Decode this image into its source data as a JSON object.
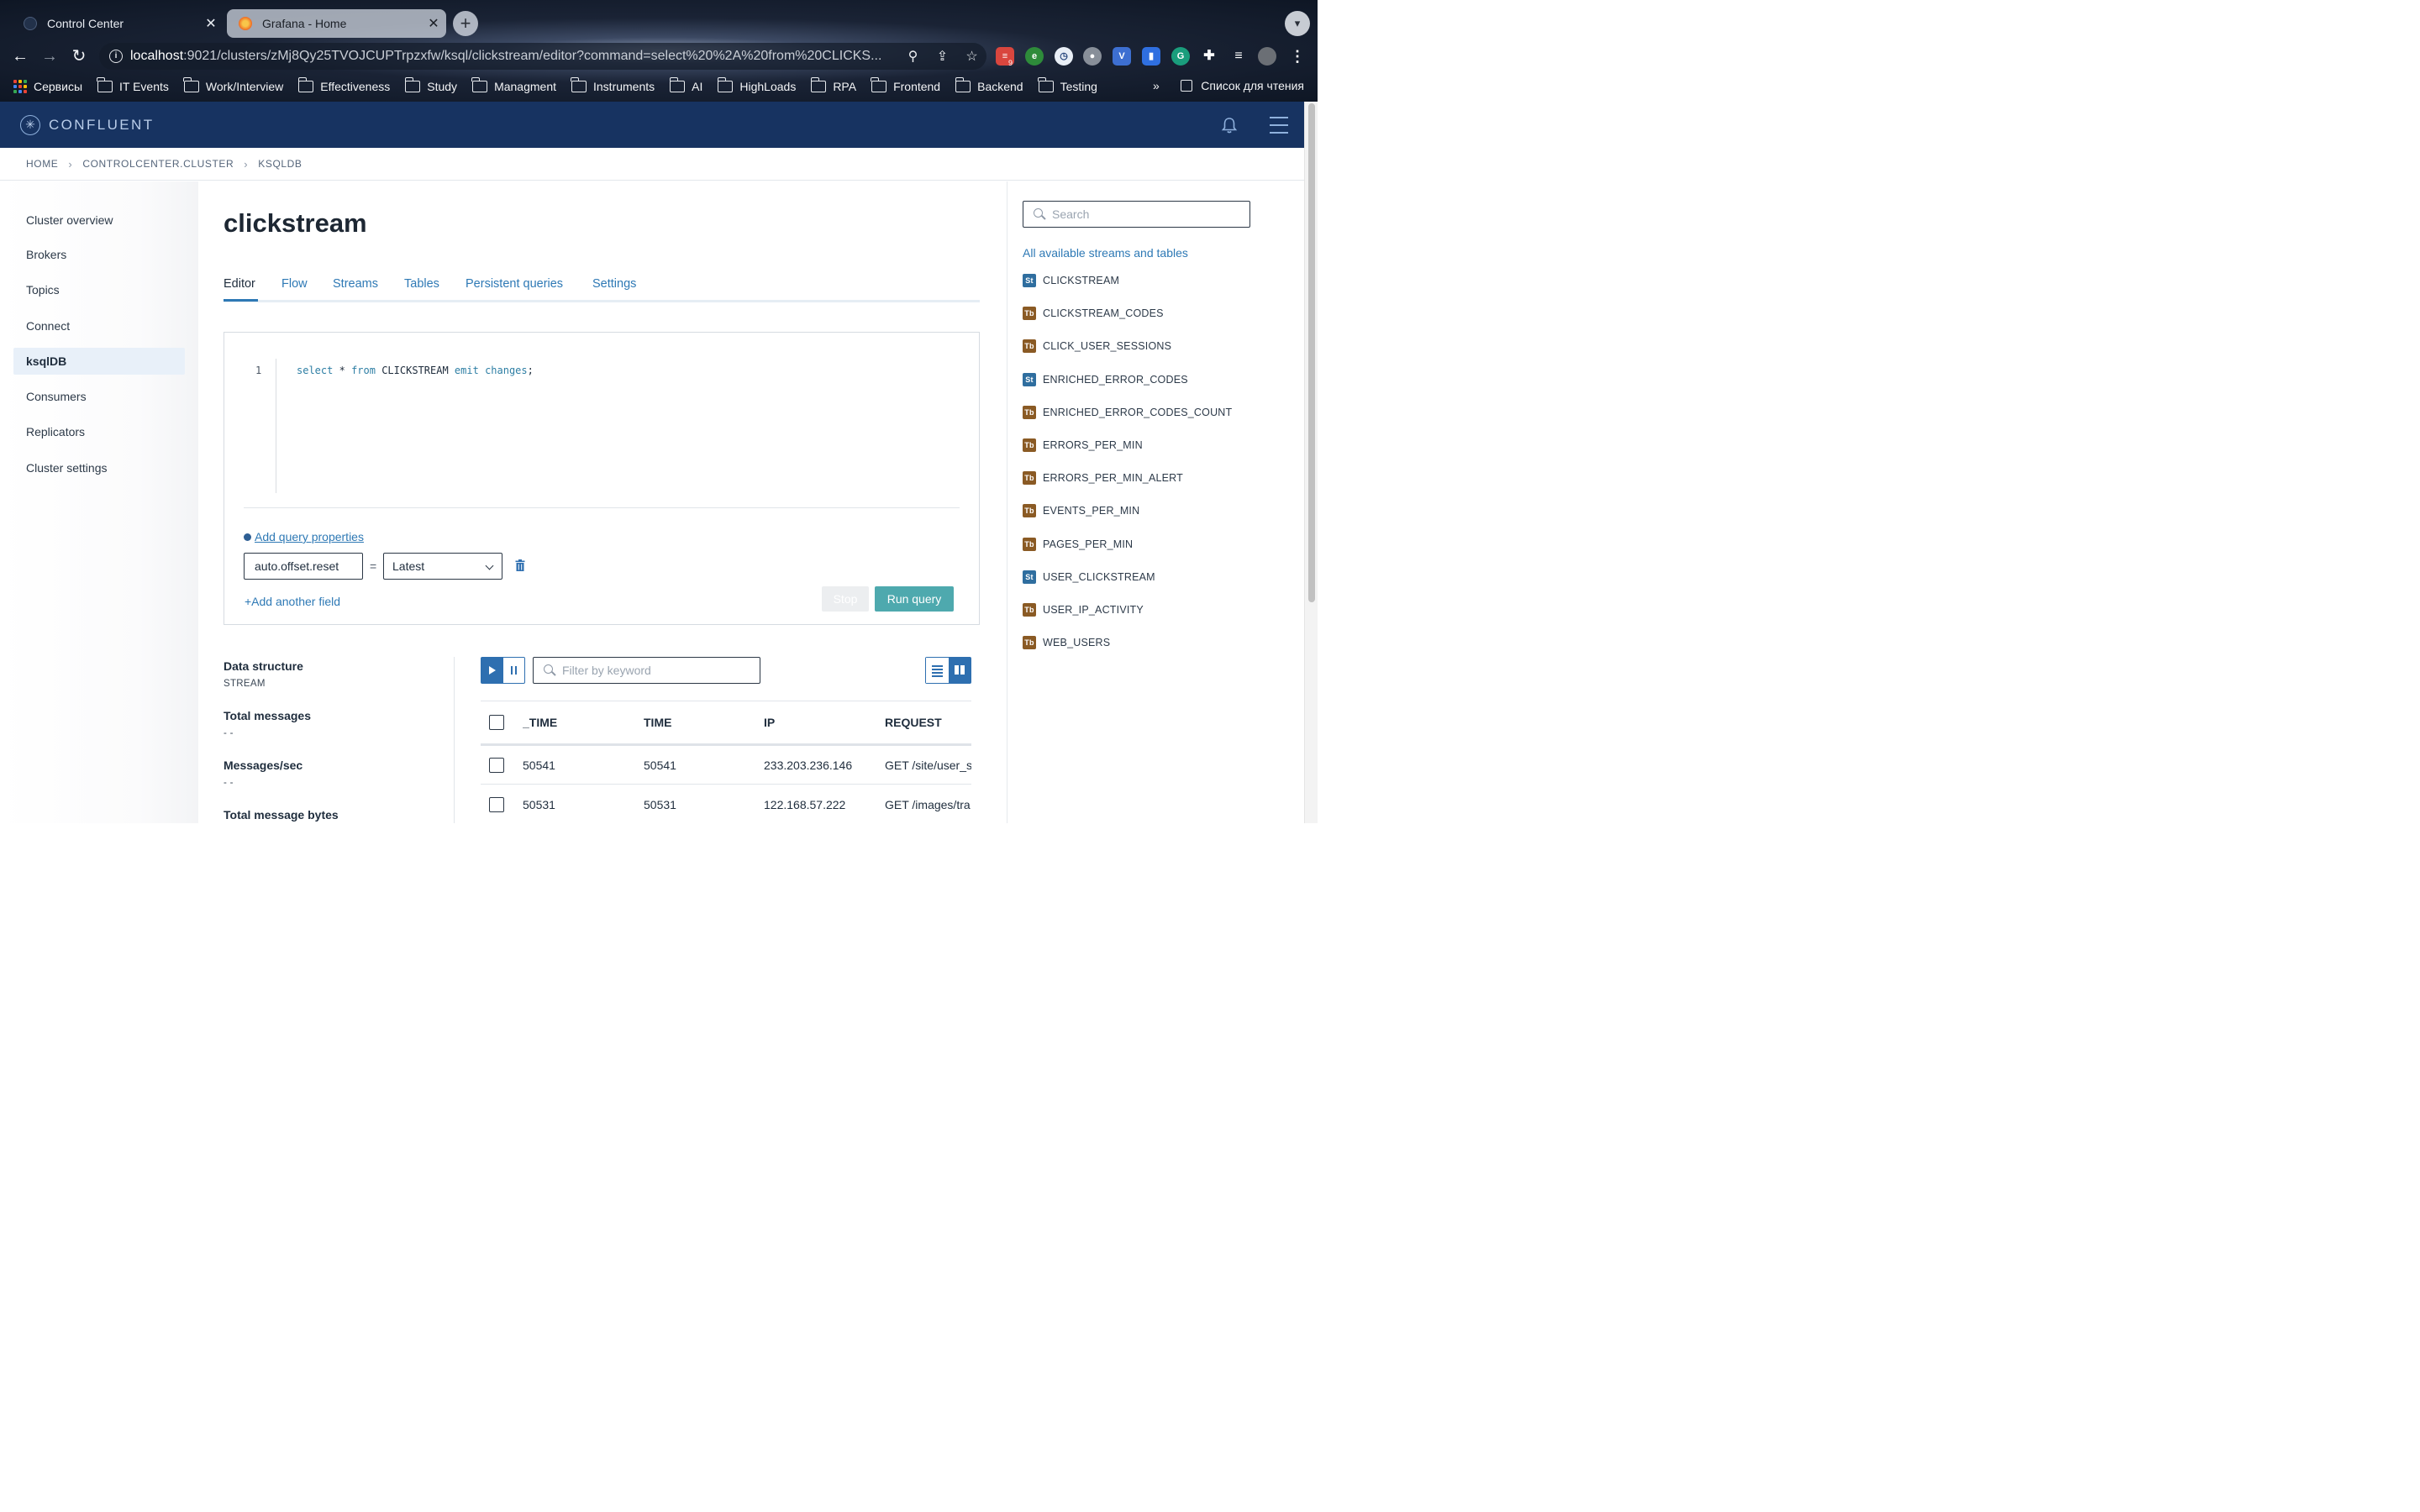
{
  "browser": {
    "tabs": [
      {
        "title": "Control Center",
        "close": "✕"
      },
      {
        "title": "Grafana - Home",
        "close": "✕"
      }
    ],
    "url_host": "localhost",
    "url_rest": ":9021/clusters/zMj8Qy25TVOJCUPTrpzxfw/ksql/clickstream/editor?command=select%20%2A%20from%20CLICKS...",
    "extension_badge": "9",
    "bookmarks": [
      "Сервисы",
      "IT Events",
      "Work/Interview",
      "Effectiveness",
      "Study",
      "Managment",
      "Instruments",
      "AI",
      "HighLoads",
      "RPA",
      "Frontend",
      "Backend",
      "Testing"
    ],
    "bookmarks_more": "»",
    "reading_list": "Список для чтения"
  },
  "app": {
    "logo_text": "CONFLUENT",
    "breadcrumb": [
      "HOME",
      "CONTROLCENTER.CLUSTER",
      "KSQLDB"
    ]
  },
  "sidebar": {
    "items": [
      "Cluster overview",
      "Brokers",
      "Topics",
      "Connect",
      "ksqlDB",
      "Consumers",
      "Replicators",
      "Cluster settings"
    ],
    "active": "ksqlDB"
  },
  "main": {
    "title": "clickstream",
    "tabs": [
      "Editor",
      "Flow",
      "Streams",
      "Tables",
      "Persistent queries",
      "Settings"
    ],
    "active_tab": "Editor",
    "editor": {
      "line_number": "1",
      "code": {
        "kw1": "select",
        "op": "*",
        "kw2": "from",
        "id": "CLICKSTREAM",
        "kw3": "emit",
        "kw4": "changes",
        "end": ";"
      }
    },
    "add_query_properties": "Add query properties",
    "property_key": "auto.offset.reset",
    "equals": "=",
    "property_value": "Latest",
    "add_field": "+Add another field",
    "stop_label": "Stop",
    "run_label": "Run query"
  },
  "stats": [
    {
      "label": "Data structure",
      "value": "STREAM"
    },
    {
      "label": "Total messages",
      "value": "- -"
    },
    {
      "label": "Messages/sec",
      "value": "- -"
    },
    {
      "label": "Total message bytes",
      "value": ""
    }
  ],
  "results": {
    "filter_placeholder": "Filter by keyword",
    "columns": [
      "_TIME",
      "TIME",
      "IP",
      "REQUEST"
    ],
    "rows": [
      [
        "50541",
        "50541",
        "233.203.236.146",
        "GET /site/user_s"
      ],
      [
        "50531",
        "50531",
        "122.168.57.222",
        "GET /images/tra"
      ]
    ]
  },
  "right_panel": {
    "search_placeholder": "Search",
    "title": "All available streams and tables",
    "items": [
      {
        "badge": "St",
        "name": "CLICKSTREAM"
      },
      {
        "badge": "Tb",
        "name": "CLICKSTREAM_CODES"
      },
      {
        "badge": "Tb",
        "name": "CLICK_USER_SESSIONS"
      },
      {
        "badge": "St",
        "name": "ENRICHED_ERROR_CODES"
      },
      {
        "badge": "Tb",
        "name": "ENRICHED_ERROR_CODES_COUNT"
      },
      {
        "badge": "Tb",
        "name": "ERRORS_PER_MIN"
      },
      {
        "badge": "Tb",
        "name": "ERRORS_PER_MIN_ALERT"
      },
      {
        "badge": "Tb",
        "name": "EVENTS_PER_MIN"
      },
      {
        "badge": "Tb",
        "name": "PAGES_PER_MIN"
      },
      {
        "badge": "St",
        "name": "USER_CLICKSTREAM"
      },
      {
        "badge": "Tb",
        "name": "USER_IP_ACTIVITY"
      },
      {
        "badge": "Tb",
        "name": "WEB_USERS"
      }
    ]
  },
  "colors": {
    "header_bg": "#173361",
    "accent": "#2e79b5",
    "run_button": "#4ea9ae",
    "stream_badge": "#2f6e9f",
    "table_badge": "#8a5a24"
  }
}
